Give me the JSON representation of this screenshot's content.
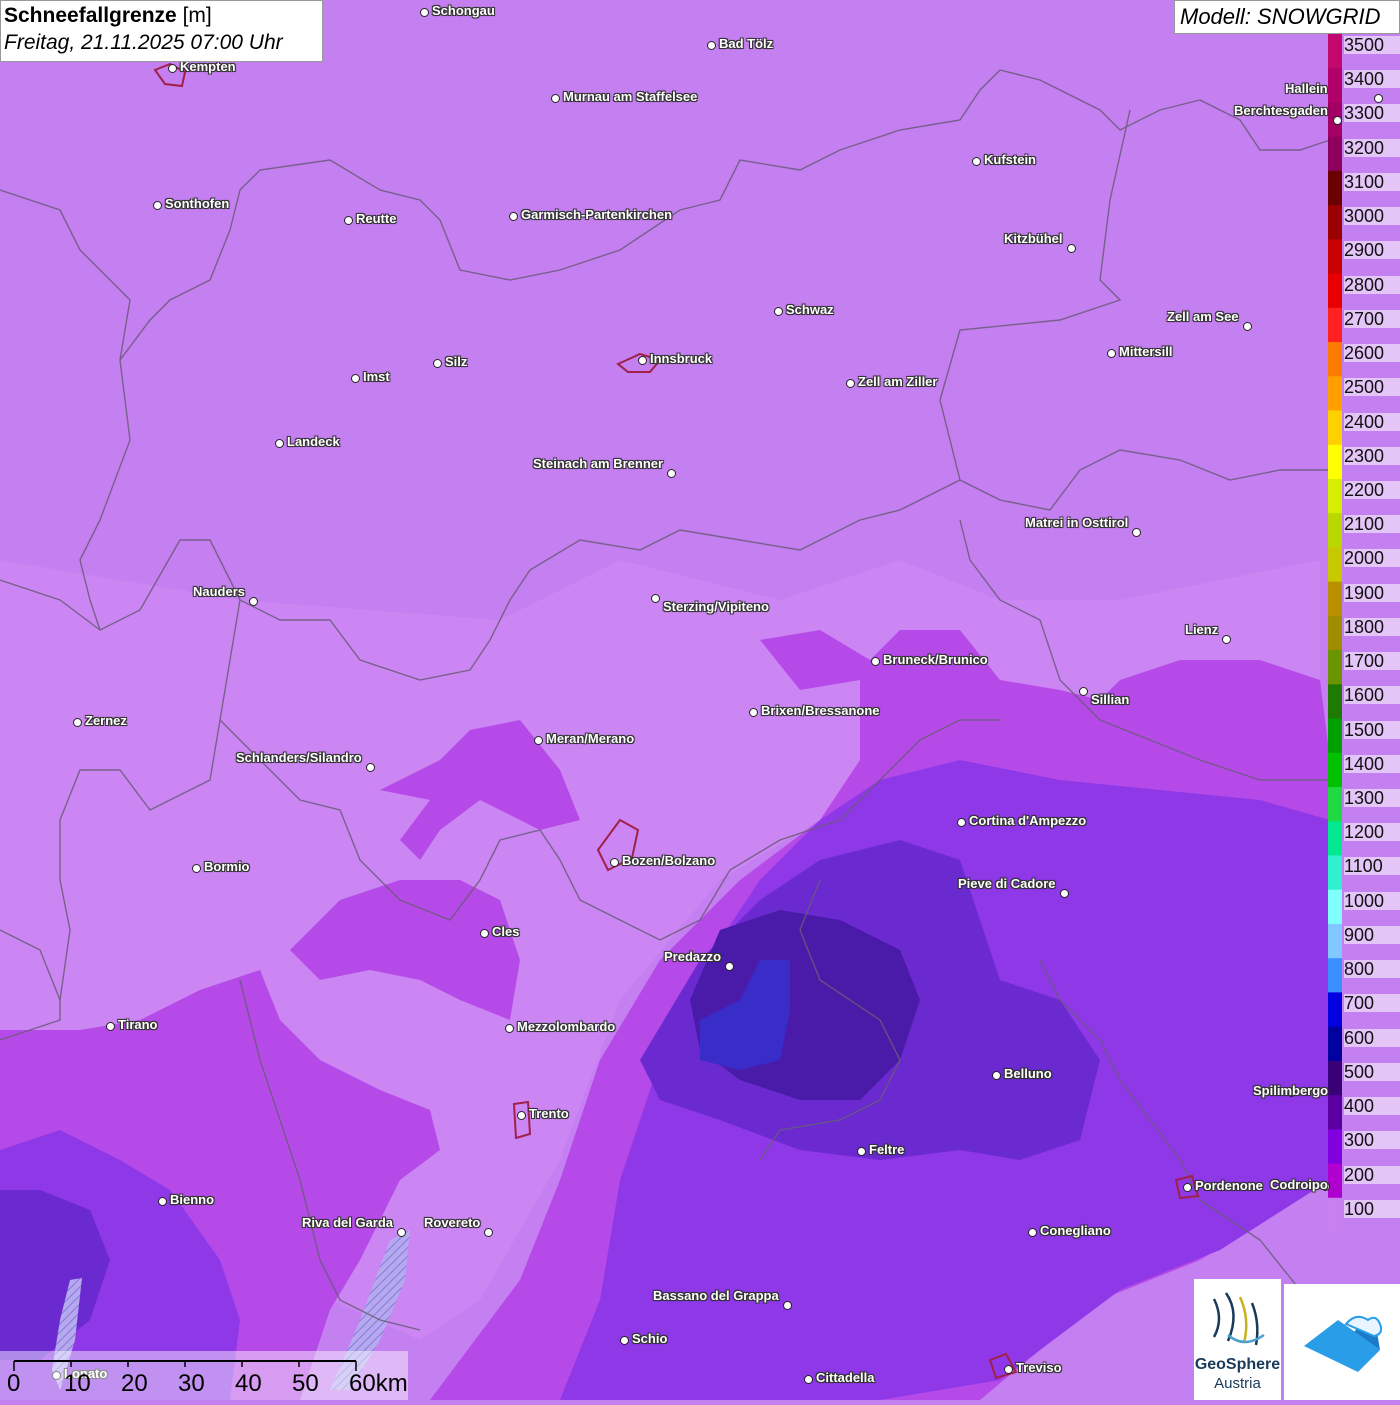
{
  "title": {
    "main": "Schneefallgrenze",
    "unit": "[m]",
    "datetime": "Freitag, 21.11.2025 07:00 Uhr"
  },
  "model_label": "Modell: SNOWGRID",
  "legend": {
    "labels": [
      "3500",
      "3400",
      "3300",
      "3200",
      "3100",
      "3000",
      "2900",
      "2800",
      "2700",
      "2600",
      "2500",
      "2400",
      "2300",
      "2200",
      "2100",
      "2000",
      "1900",
      "1800",
      "1700",
      "1600",
      "1500",
      "1400",
      "1300",
      "1200",
      "1100",
      "1000",
      "900",
      "800",
      "700",
      "600",
      "500",
      "400",
      "300",
      "200",
      "100"
    ],
    "colors": [
      "#c2086e",
      "#b2006a",
      "#a30066",
      "#8e005c",
      "#6a0000",
      "#9a0000",
      "#c80000",
      "#e80000",
      "#ff2020",
      "#ff7a00",
      "#ffa000",
      "#ffd000",
      "#ffff00",
      "#d4f000",
      "#b8d800",
      "#c8c800",
      "#b89000",
      "#a08c00",
      "#6a9400",
      "#1e7a00",
      "#00a000",
      "#00c000",
      "#20d840",
      "#00e890",
      "#30f0d0",
      "#80ffff",
      "#80c8ff",
      "#3a90ff",
      "#0000e0",
      "#0000a0",
      "#3a0078",
      "#5a00a0",
      "#8000e0",
      "#b000d0",
      "#c87ff0"
    ]
  },
  "cities": [
    {
      "name": "Schongau"
    },
    {
      "name": "Kempten"
    },
    {
      "name": "Bad Tölz"
    },
    {
      "name": "Murnau am Staffelsee"
    },
    {
      "name": "Hallein"
    },
    {
      "name": "Berchtesgaden"
    },
    {
      "name": "Kufstein"
    },
    {
      "name": "Sonthofen"
    },
    {
      "name": "Reutte"
    },
    {
      "name": "Garmisch-Partenkirchen"
    },
    {
      "name": "Kitzbühel"
    },
    {
      "name": "Schwaz"
    },
    {
      "name": "Zell am See"
    },
    {
      "name": "Innsbruck"
    },
    {
      "name": "Mittersill"
    },
    {
      "name": "Silz"
    },
    {
      "name": "Imst"
    },
    {
      "name": "Zell am Ziller"
    },
    {
      "name": "Landeck"
    },
    {
      "name": "Steinach am Brenner"
    },
    {
      "name": "Matrei in Osttirol"
    },
    {
      "name": "Nauders"
    },
    {
      "name": "Sterzing/Vipiteno"
    },
    {
      "name": "Lienz"
    },
    {
      "name": "Bruneck/Brunico"
    },
    {
      "name": "Sillian"
    },
    {
      "name": "Zernez"
    },
    {
      "name": "Brixen/Bressanone"
    },
    {
      "name": "Meran/Merano"
    },
    {
      "name": "Schlanders/Silandro"
    },
    {
      "name": "Cortina d'Ampezzo"
    },
    {
      "name": "Bozen/Bolzano"
    },
    {
      "name": "Bormio"
    },
    {
      "name": "Pieve di Cadore"
    },
    {
      "name": "Cles"
    },
    {
      "name": "Predazzo"
    },
    {
      "name": "Tirano"
    },
    {
      "name": "Mezzolombardo"
    },
    {
      "name": "Belluno"
    },
    {
      "name": "Spilimbergo"
    },
    {
      "name": "Trento"
    },
    {
      "name": "Feltre"
    },
    {
      "name": "Pordenone"
    },
    {
      "name": "Bienno"
    },
    {
      "name": "Riva del Garda"
    },
    {
      "name": "Rovereto"
    },
    {
      "name": "Conegliano"
    },
    {
      "name": "Bassano del Grappa"
    },
    {
      "name": "Schio"
    },
    {
      "name": "Treviso"
    },
    {
      "name": "Cittadella"
    },
    {
      "name": "Lonato"
    },
    {
      "name": "Codroipo"
    }
  ],
  "scale": {
    "ticks": [
      "0",
      "10",
      "20",
      "30",
      "40",
      "50",
      "60km"
    ]
  },
  "logos": {
    "geosphere_line1": "GeoSphere",
    "geosphere_line2": "Austria"
  }
}
